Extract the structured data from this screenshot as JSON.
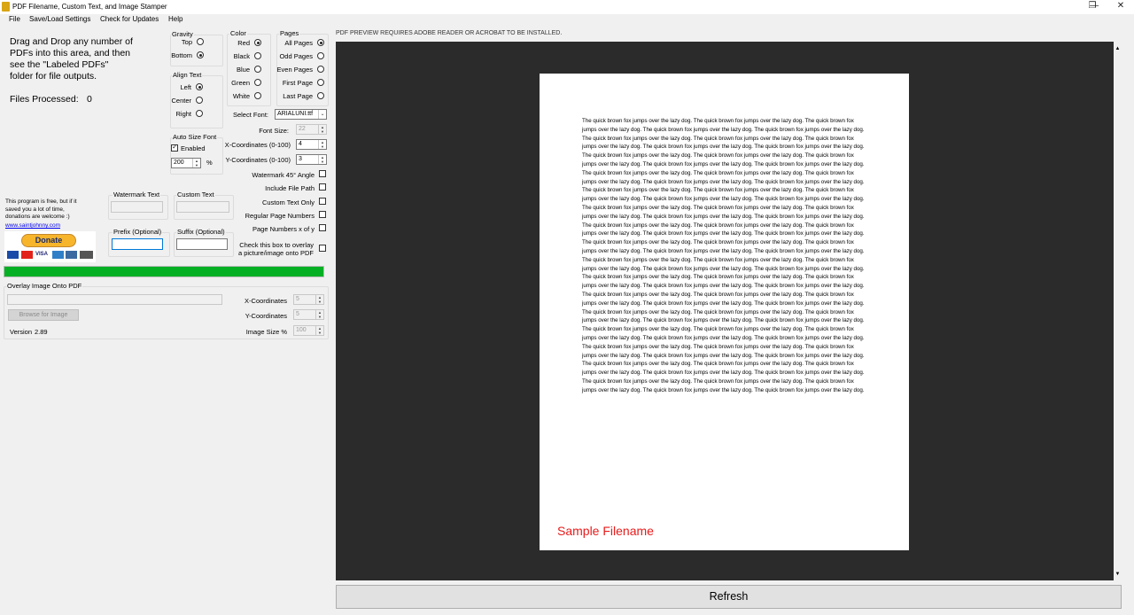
{
  "window": {
    "title": "PDF Filename, Custom Text, and Image Stamper",
    "minimize_glyph": "—",
    "restore_glyph": "❐",
    "close_glyph": "✕"
  },
  "menu": {
    "file": "File",
    "save_load": "Save/Load Settings",
    "check_updates": "Check for Updates",
    "help": "Help"
  },
  "drop_zone": {
    "instructions": "Drag and Drop any number of PDFs into this area, and then see the \"Labeled PDFs\" folder for file outputs.",
    "files_processed_label": "Files Processed:",
    "files_processed_value": "0"
  },
  "gravity": {
    "label": "Gravity",
    "top": "Top",
    "bottom": "Bottom",
    "selected": "Bottom"
  },
  "align": {
    "label": "Align Text",
    "left": "Left",
    "center": "Center",
    "right": "Right",
    "selected": "Left"
  },
  "auto_size": {
    "label": "Auto Size Font",
    "enabled_label": "Enabled",
    "enabled": true,
    "value": "200",
    "unit": "%"
  },
  "color": {
    "label": "Color",
    "red": "Red",
    "black": "Black",
    "blue": "Blue",
    "green": "Green",
    "white": "White",
    "selected": "Red"
  },
  "pages": {
    "label": "Pages",
    "all": "All Pages",
    "odd": "Odd Pages",
    "even": "Even Pages",
    "first": "First Page",
    "last": "Last Page",
    "selected": "All Pages"
  },
  "font": {
    "select_label": "Select Font:",
    "selected_font": "ARIALUNI.ttf",
    "size_label": "Font Size:",
    "size_value": "22",
    "x_label": "X-Coordinates (0-100)",
    "x_value": "4",
    "y_label": "Y-Coordinates (0-100)",
    "y_value": "3"
  },
  "options": {
    "watermark_angle": "Watermark 45° Angle",
    "include_path": "Include File Path",
    "custom_only": "Custom Text Only",
    "regular_page_numbers": "Regular Page Numbers",
    "page_numbers_xy": "Page Numbers x of y",
    "overlay_image": "Check this box to overlay a picture/image onto PDF"
  },
  "text_fields": {
    "watermark_label": "Watermark Text",
    "watermark_value": "",
    "custom_label": "Custom Text",
    "custom_value": "",
    "prefix_label": "Prefix (Optional)",
    "prefix_value": "",
    "suffix_label": "Suffix (Optional)",
    "suffix_value": ""
  },
  "donation": {
    "message": "This program is free, but if it saved you a lot of time, donations are welcome :)",
    "link": "www.saintjohnny.com",
    "button_label": "Donate",
    "cards": [
      "VISA",
      "MC",
      "AMEX",
      "BANK"
    ]
  },
  "progress": {
    "fraction": 1.0
  },
  "overlay": {
    "label": "Overlay Image Onto PDF",
    "path_value": "",
    "browse_label": "Browse for Image",
    "x_label": "X-Coordinates",
    "x_value": "5",
    "y_label": "Y-Coordinates",
    "y_value": "5",
    "size_label": "Image Size %",
    "size_value": "100"
  },
  "version": {
    "label": "Version",
    "value": "2.89"
  },
  "preview": {
    "notice": "PDF PREVIEW REQUIRES ADOBE READER OR ACROBAT TO BE INSTALLED.",
    "body_text": "The quick brown fox jumps over the lazy dog.  The quick brown fox jumps over the lazy dog.  The quick brown fox jumps over the lazy dog.  The quick brown fox jumps over the lazy dog.  The quick brown fox jumps over the lazy dog.  The quick brown fox jumps over the lazy dog.  The quick brown fox jumps over the lazy dog.  The quick brown fox jumps over the lazy dog.  The quick brown fox jumps over the lazy dog.  The quick brown fox jumps over the lazy dog.  The quick brown fox jumps over the lazy dog.  The quick brown fox jumps over the lazy dog.  The quick brown fox jumps over the lazy dog.  The quick brown fox jumps over the lazy dog.  The quick brown fox jumps over the lazy dog.  The quick brown fox jumps over the lazy dog.  The quick brown fox jumps over the lazy dog.  The quick brown fox jumps over the lazy dog.  The quick brown fox jumps over the lazy dog.  The quick brown fox jumps over the lazy dog.  The quick brown fox jumps over the lazy dog.  The quick brown fox jumps over the lazy dog.  The quick brown fox jumps over the lazy dog.  The quick brown fox jumps over the lazy dog.  The quick brown fox jumps over the lazy dog.  The quick brown fox jumps over the lazy dog.  The quick brown fox jumps over the lazy dog.  The quick brown fox jumps over the lazy dog.  The quick brown fox jumps over the lazy dog.  The quick brown fox jumps over the lazy dog.  The quick brown fox jumps over the lazy dog.  The quick brown fox jumps over the lazy dog.  The quick brown fox jumps over the lazy dog.  The quick brown fox jumps over the lazy dog.  The quick brown fox jumps over the lazy dog.  The quick brown fox jumps over the lazy dog.  The quick brown fox jumps over the lazy dog.  The quick brown fox jumps over the lazy dog.  The quick brown fox jumps over the lazy dog.  The quick brown fox jumps over the lazy dog.  The quick brown fox jumps over the lazy dog.  The quick brown fox jumps over the lazy dog.  The quick brown fox jumps over the lazy dog.  The quick brown fox jumps over the lazy dog.  The quick brown fox jumps over the lazy dog.  The quick brown fox jumps over the lazy dog.  The quick brown fox jumps over the lazy dog.  The quick brown fox jumps over the lazy dog.  The quick brown fox jumps over the lazy dog.  The quick brown fox jumps over the lazy dog.  The quick brown fox jumps over the lazy dog.  The quick brown fox jumps over the lazy dog.  The quick brown fox jumps over the lazy dog.  The quick brown fox jumps over the lazy dog.  The quick brown fox jumps over the lazy dog.  The quick brown fox jumps over the lazy dog.  The quick brown fox jumps over the lazy dog.  The quick brown fox jumps over the lazy dog.  The quick brown fox jumps over the lazy dog.  The quick brown fox jumps over the lazy dog.  The quick brown fox jumps over the lazy dog.  The quick brown fox jumps over the lazy dog.  The quick brown fox jumps over the lazy dog.  The quick brown fox jumps over the lazy dog.  The quick brown fox jumps over the lazy dog.  The quick brown fox jumps over the lazy dog.  The quick brown fox jumps over the lazy dog.  The quick brown fox jumps over the lazy dog.  The quick brown fox jumps over the lazy dog.  The quick brown fox jumps over the lazy dog.  The quick brown fox jumps over the lazy dog.  The quick brown fox jumps over the lazy dog.  The quick brown fox jumps over the lazy dog.  The quick brown fox jumps over the lazy dog.  The quick brown fox jumps over the lazy dog.  The quick brown fox jumps over the lazy dog.  The quick brown fox jumps over the lazy dog.  The quick brown fox jumps over the lazy dog.  The quick brown fox jumps over the lazy dog.  The quick brown fox jumps over the lazy dog.",
    "stamp_text": "Sample Filename",
    "stamp_color": "#e81b1b",
    "scroll_up": "▲",
    "scroll_down": "▼"
  },
  "refresh_label": "Refresh",
  "colors": {
    "progress": "#06b025",
    "preview_bg": "#2b2b2b",
    "donate": "#f7b52c"
  }
}
